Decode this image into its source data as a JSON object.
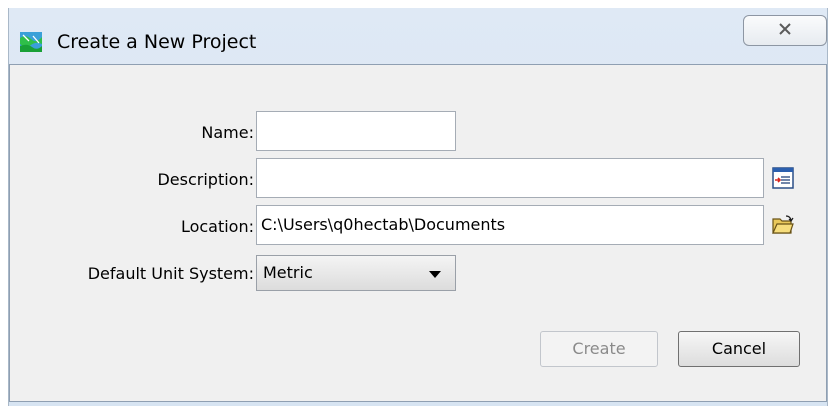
{
  "window": {
    "title": "Create a New Project",
    "close_glyph": "✕"
  },
  "form": {
    "name_label": "Name:",
    "name_value": "",
    "description_label": "Description:",
    "description_value": "",
    "location_label": "Location:",
    "location_value": "C:\\Users\\q0hectab\\Documents",
    "unit_label": "Default Unit System:",
    "unit_value": "Metric"
  },
  "buttons": {
    "create": "Create",
    "cancel": "Cancel"
  },
  "icons": {
    "app": "project-map-icon",
    "description": "edit-description-icon",
    "location": "open-folder-icon"
  }
}
